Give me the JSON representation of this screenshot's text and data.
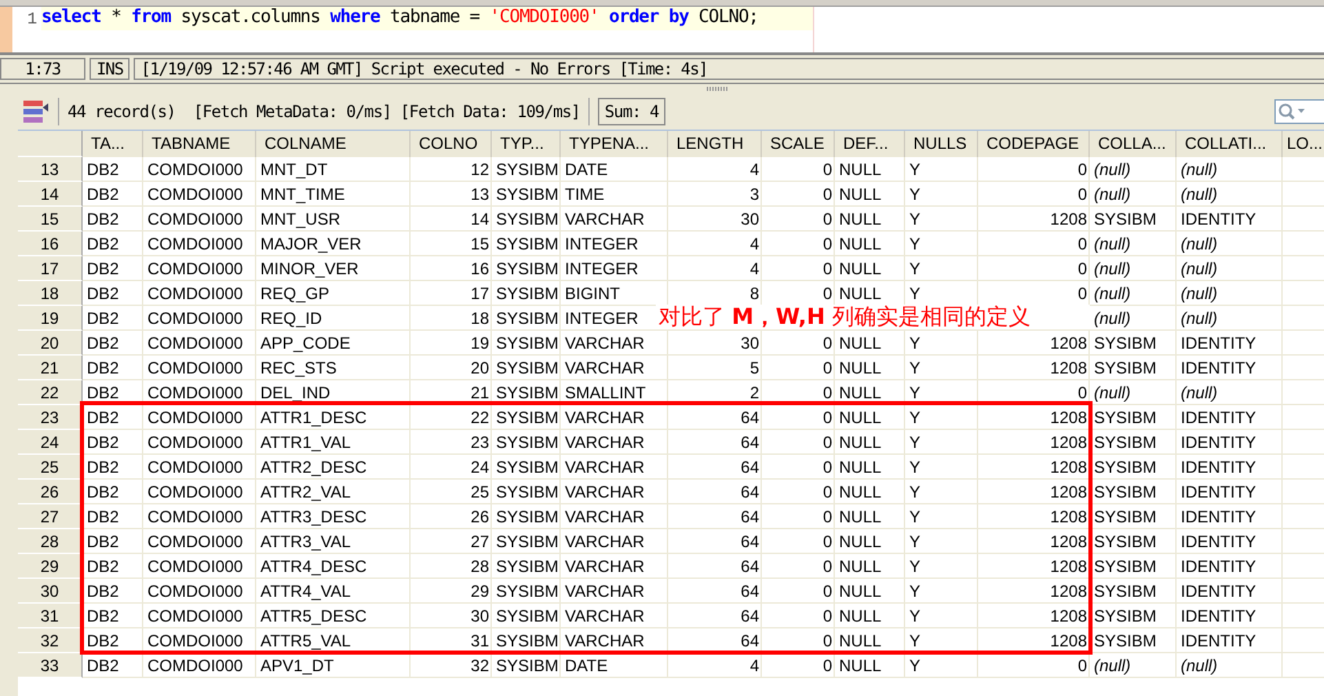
{
  "editor": {
    "line_number": "1",
    "tokens": [
      {
        "kind": "keyword",
        "text": "select"
      },
      {
        "kind": "plain",
        "text": " * "
      },
      {
        "kind": "keyword",
        "text": "from"
      },
      {
        "kind": "plain",
        "text": " syscat.columns "
      },
      {
        "kind": "keyword",
        "text": "where"
      },
      {
        "kind": "plain",
        "text": " tabname = "
      },
      {
        "kind": "string",
        "text": "'COMDOI000'"
      },
      {
        "kind": "keyword",
        "text": " order by"
      },
      {
        "kind": "plain",
        "text": " COLNO;"
      }
    ]
  },
  "status_bar": {
    "position": "1:73",
    "mode": "INS",
    "message": "[1/19/09 12:57:46 AM GMT] Script executed - No Errors [Time: 4s]"
  },
  "results_toolbar": {
    "summary": "44 record(s)  [Fetch MetaData: 0/ms] [Fetch Data: 109/ms]",
    "sum": "Sum: 4"
  },
  "table": {
    "columns": [
      "TA...",
      "TABNAME",
      "COLNAME",
      "COLNO",
      "TYP...",
      "TYPENA...",
      "LENGTH",
      "SCALE",
      "DEF...",
      "NULLS",
      "CODEPAGE",
      "COLLA...",
      "COLLATI...",
      "LO..."
    ],
    "rows": [
      {
        "row": "13",
        "cells": [
          "DB2",
          "COMDOI000",
          "MNT_DT",
          "12",
          "SYSIBM",
          "DATE",
          "4",
          "0",
          "NULL",
          "Y",
          "0",
          {
            "kind": "null",
            "text": "(null)"
          },
          {
            "kind": "null",
            "text": "(null)"
          }
        ]
      },
      {
        "row": "14",
        "cells": [
          "DB2",
          "COMDOI000",
          "MNT_TIME",
          "13",
          "SYSIBM",
          "TIME",
          "3",
          "0",
          "NULL",
          "Y",
          "0",
          {
            "kind": "null",
            "text": "(null)"
          },
          {
            "kind": "null",
            "text": "(null)"
          }
        ]
      },
      {
        "row": "15",
        "cells": [
          "DB2",
          "COMDOI000",
          "MNT_USR",
          "14",
          "SYSIBM",
          "VARCHAR",
          "30",
          "0",
          "NULL",
          "Y",
          "1208",
          "SYSIBM",
          "IDENTITY"
        ]
      },
      {
        "row": "16",
        "cells": [
          "DB2",
          "COMDOI000",
          "MAJOR_VER",
          "15",
          "SYSIBM",
          "INTEGER",
          "4",
          "0",
          "NULL",
          "Y",
          "0",
          {
            "kind": "null",
            "text": "(null)"
          },
          {
            "kind": "null",
            "text": "(null)"
          }
        ]
      },
      {
        "row": "17",
        "cells": [
          "DB2",
          "COMDOI000",
          "MINOR_VER",
          "16",
          "SYSIBM",
          "INTEGER",
          "4",
          "0",
          "NULL",
          "Y",
          "0",
          {
            "kind": "null",
            "text": "(null)"
          },
          {
            "kind": "null",
            "text": "(null)"
          }
        ]
      },
      {
        "row": "18",
        "cells": [
          "DB2",
          "COMDOI000",
          "REQ_GP",
          "17",
          "SYSIBM",
          "BIGINT",
          "8",
          "0",
          "NULL",
          "Y",
          "0",
          {
            "kind": "null",
            "text": "(null)"
          },
          {
            "kind": "null",
            "text": "(null)"
          }
        ]
      },
      {
        "row": "19",
        "cells": [
          "DB2",
          "COMDOI000",
          "REQ_ID",
          "18",
          "SYSIBM",
          "INTEGER",
          null,
          null,
          null,
          null,
          null,
          {
            "kind": "null",
            "text": "(null)"
          },
          {
            "kind": "null",
            "text": "(null)"
          }
        ]
      },
      {
        "row": "20",
        "cells": [
          "DB2",
          "COMDOI000",
          "APP_CODE",
          "19",
          "SYSIBM",
          "VARCHAR",
          "30",
          "0",
          "NULL",
          "Y",
          "1208",
          "SYSIBM",
          "IDENTITY"
        ]
      },
      {
        "row": "21",
        "cells": [
          "DB2",
          "COMDOI000",
          "REC_STS",
          "20",
          "SYSIBM",
          "VARCHAR",
          "5",
          "0",
          "NULL",
          "Y",
          "1208",
          "SYSIBM",
          "IDENTITY"
        ]
      },
      {
        "row": "22",
        "cells": [
          "DB2",
          "COMDOI000",
          "DEL_IND",
          "21",
          "SYSIBM",
          "SMALLINT",
          "2",
          "0",
          "NULL",
          "Y",
          "0",
          {
            "kind": "null",
            "text": "(null)"
          },
          {
            "kind": "null",
            "text": "(null)"
          }
        ]
      },
      {
        "row": "23",
        "cells": [
          "DB2",
          "COMDOI000",
          "ATTR1_DESC",
          "22",
          "SYSIBM",
          "VARCHAR",
          "64",
          "0",
          "NULL",
          "Y",
          "1208",
          "SYSIBM",
          "IDENTITY"
        ]
      },
      {
        "row": "24",
        "cells": [
          "DB2",
          "COMDOI000",
          "ATTR1_VAL",
          "23",
          "SYSIBM",
          "VARCHAR",
          "64",
          "0",
          "NULL",
          "Y",
          "1208",
          "SYSIBM",
          "IDENTITY"
        ]
      },
      {
        "row": "25",
        "cells": [
          "DB2",
          "COMDOI000",
          "ATTR2_DESC",
          "24",
          "SYSIBM",
          "VARCHAR",
          "64",
          "0",
          "NULL",
          "Y",
          "1208",
          "SYSIBM",
          "IDENTITY"
        ]
      },
      {
        "row": "26",
        "cells": [
          "DB2",
          "COMDOI000",
          "ATTR2_VAL",
          "25",
          "SYSIBM",
          "VARCHAR",
          "64",
          "0",
          "NULL",
          "Y",
          "1208",
          "SYSIBM",
          "IDENTITY"
        ]
      },
      {
        "row": "27",
        "cells": [
          "DB2",
          "COMDOI000",
          "ATTR3_DESC",
          "26",
          "SYSIBM",
          "VARCHAR",
          "64",
          "0",
          "NULL",
          "Y",
          "1208",
          "SYSIBM",
          "IDENTITY"
        ]
      },
      {
        "row": "28",
        "cells": [
          "DB2",
          "COMDOI000",
          "ATTR3_VAL",
          "27",
          "SYSIBM",
          "VARCHAR",
          "64",
          "0",
          "NULL",
          "Y",
          "1208",
          "SYSIBM",
          "IDENTITY"
        ]
      },
      {
        "row": "29",
        "cells": [
          "DB2",
          "COMDOI000",
          "ATTR4_DESC",
          "28",
          "SYSIBM",
          "VARCHAR",
          "64",
          "0",
          "NULL",
          "Y",
          "1208",
          "SYSIBM",
          "IDENTITY"
        ]
      },
      {
        "row": "30",
        "cells": [
          "DB2",
          "COMDOI000",
          "ATTR4_VAL",
          "29",
          "SYSIBM",
          "VARCHAR",
          "64",
          "0",
          "NULL",
          "Y",
          "1208",
          "SYSIBM",
          "IDENTITY"
        ]
      },
      {
        "row": "31",
        "cells": [
          "DB2",
          "COMDOI000",
          "ATTR5_DESC",
          "30",
          "SYSIBM",
          "VARCHAR",
          "64",
          "0",
          "NULL",
          "Y",
          "1208",
          "SYSIBM",
          "IDENTITY"
        ]
      },
      {
        "row": "32",
        "cells": [
          "DB2",
          "COMDOI000",
          "ATTR5_VAL",
          "31",
          "SYSIBM",
          "VARCHAR",
          "64",
          "0",
          "NULL",
          "Y",
          "1208",
          "SYSIBM",
          "IDENTITY"
        ]
      },
      {
        "row": "33",
        "cells": [
          "DB2",
          "COMDOI000",
          "APV1_DT",
          "32",
          "SYSIBM",
          "DATE",
          "4",
          "0",
          "NULL",
          "Y",
          "0",
          {
            "kind": "null",
            "text": "(null)"
          },
          {
            "kind": "null",
            "text": "(null)"
          }
        ]
      }
    ]
  },
  "annotation": {
    "text": "对比了 **M，W,H** 列确实是相同的定义"
  }
}
